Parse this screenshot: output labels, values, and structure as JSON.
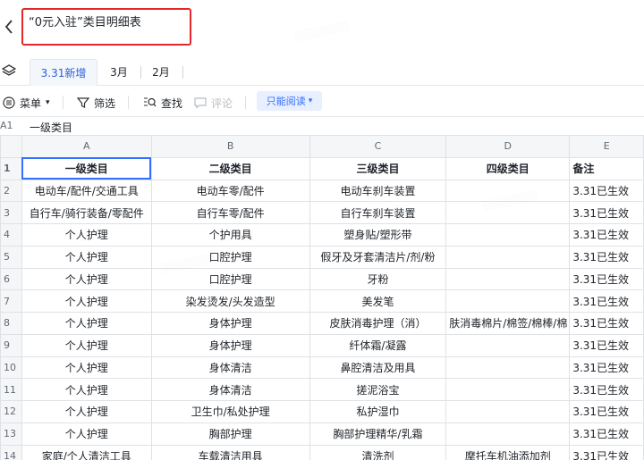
{
  "header": {
    "back_icon": "chevron-left-icon",
    "title": "“0元入驻”类目明细表"
  },
  "tabs": [
    {
      "label": "3.31新增",
      "active": true
    },
    {
      "label": "3月",
      "active": false
    },
    {
      "label": "2月",
      "active": false
    }
  ],
  "toolbar": {
    "menu_label": "菜单",
    "filter_label": "筛选",
    "find_label": "查找",
    "comment_label": "评论",
    "readonly_label": "只能阅读"
  },
  "formula": {
    "cell_ref": "A1",
    "value": "一级类目"
  },
  "grid": {
    "columns": [
      "A",
      "B",
      "C",
      "D",
      "E"
    ],
    "rows": [
      {
        "n": "1",
        "cells": [
          "一级类目",
          "二级类目",
          "三级类目",
          "四级类目",
          "备注"
        ]
      },
      {
        "n": "2",
        "cells": [
          "电动车/配件/交通工具",
          "电动车零/配件",
          "电动车刹车装置",
          "",
          "3.31已生效"
        ]
      },
      {
        "n": "3",
        "cells": [
          "自行车/骑行装备/零配件",
          "自行车零/配件",
          "自行车刹车装置",
          "",
          "3.31已生效"
        ]
      },
      {
        "n": "4",
        "cells": [
          "个人护理",
          "个护用具",
          "塑身贴/塑形带",
          "",
          "3.31已生效"
        ]
      },
      {
        "n": "5",
        "cells": [
          "个人护理",
          "口腔护理",
          "假牙及牙套清洁片/剂/粉",
          "",
          "3.31已生效"
        ]
      },
      {
        "n": "6",
        "cells": [
          "个人护理",
          "口腔护理",
          "牙粉",
          "",
          "3.31已生效"
        ]
      },
      {
        "n": "7",
        "cells": [
          "个人护理",
          "染发烫发/头发造型",
          "美发笔",
          "",
          "3.31已生效"
        ]
      },
      {
        "n": "8",
        "cells": [
          "个人护理",
          "身体护理",
          "皮肤消毒护理（消）",
          "肤消毒棉片/棉签/棉棒/棉",
          "3.31已生效"
        ]
      },
      {
        "n": "9",
        "cells": [
          "个人护理",
          "身体护理",
          "纤体霜/凝露",
          "",
          "3.31已生效"
        ]
      },
      {
        "n": "10",
        "cells": [
          "个人护理",
          "身体清洁",
          "鼻腔清洁及用具",
          "",
          "3.31已生效"
        ]
      },
      {
        "n": "11",
        "cells": [
          "个人护理",
          "身体清洁",
          "搓泥浴宝",
          "",
          "3.31已生效"
        ]
      },
      {
        "n": "12",
        "cells": [
          "个人护理",
          "卫生巾/私处护理",
          "私护湿巾",
          "",
          "3.31已生效"
        ]
      },
      {
        "n": "13",
        "cells": [
          "个人护理",
          "胸部护理",
          "胸部护理精华/乳霜",
          "",
          "3.31已生效"
        ]
      },
      {
        "n": "14",
        "cells": [
          "家庭/个人清洁工具",
          "车载清洁用具",
          "清洗剂",
          "摩托车机油添加剂",
          "3.31已生效"
        ]
      }
    ]
  },
  "colors": {
    "accent": "#3370ff",
    "highlight_box": "#e5262b"
  }
}
